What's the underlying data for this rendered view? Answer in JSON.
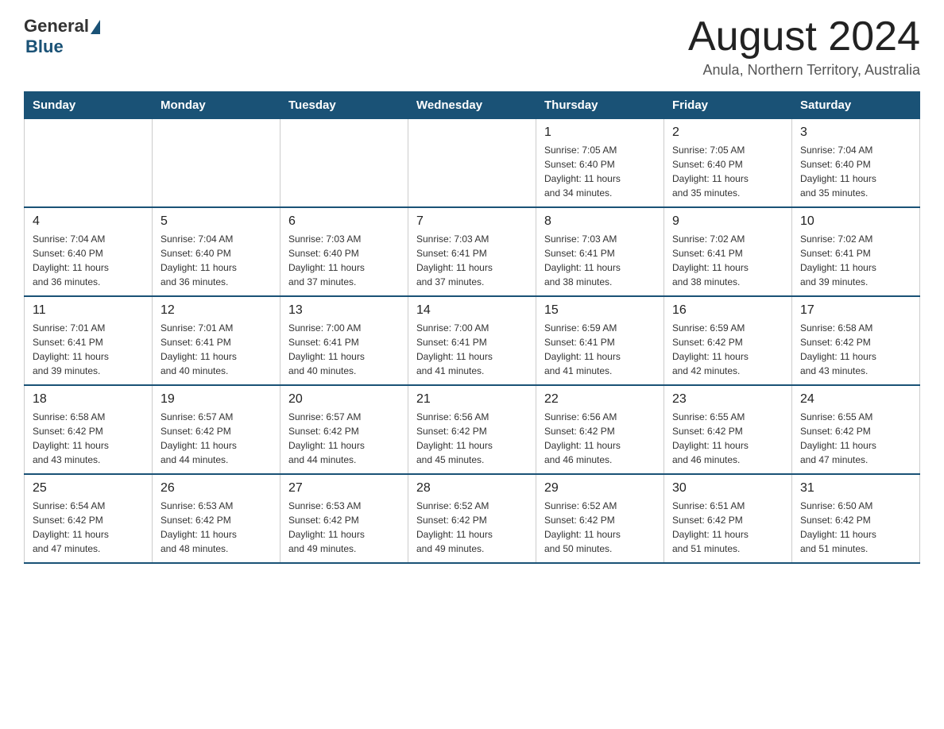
{
  "header": {
    "logo_general": "General",
    "logo_blue": "Blue",
    "month_title": "August 2024",
    "location": "Anula, Northern Territory, Australia"
  },
  "days_of_week": [
    "Sunday",
    "Monday",
    "Tuesday",
    "Wednesday",
    "Thursday",
    "Friday",
    "Saturday"
  ],
  "weeks": [
    [
      {
        "day": "",
        "info": ""
      },
      {
        "day": "",
        "info": ""
      },
      {
        "day": "",
        "info": ""
      },
      {
        "day": "",
        "info": ""
      },
      {
        "day": "1",
        "info": "Sunrise: 7:05 AM\nSunset: 6:40 PM\nDaylight: 11 hours\nand 34 minutes."
      },
      {
        "day": "2",
        "info": "Sunrise: 7:05 AM\nSunset: 6:40 PM\nDaylight: 11 hours\nand 35 minutes."
      },
      {
        "day": "3",
        "info": "Sunrise: 7:04 AM\nSunset: 6:40 PM\nDaylight: 11 hours\nand 35 minutes."
      }
    ],
    [
      {
        "day": "4",
        "info": "Sunrise: 7:04 AM\nSunset: 6:40 PM\nDaylight: 11 hours\nand 36 minutes."
      },
      {
        "day": "5",
        "info": "Sunrise: 7:04 AM\nSunset: 6:40 PM\nDaylight: 11 hours\nand 36 minutes."
      },
      {
        "day": "6",
        "info": "Sunrise: 7:03 AM\nSunset: 6:40 PM\nDaylight: 11 hours\nand 37 minutes."
      },
      {
        "day": "7",
        "info": "Sunrise: 7:03 AM\nSunset: 6:41 PM\nDaylight: 11 hours\nand 37 minutes."
      },
      {
        "day": "8",
        "info": "Sunrise: 7:03 AM\nSunset: 6:41 PM\nDaylight: 11 hours\nand 38 minutes."
      },
      {
        "day": "9",
        "info": "Sunrise: 7:02 AM\nSunset: 6:41 PM\nDaylight: 11 hours\nand 38 minutes."
      },
      {
        "day": "10",
        "info": "Sunrise: 7:02 AM\nSunset: 6:41 PM\nDaylight: 11 hours\nand 39 minutes."
      }
    ],
    [
      {
        "day": "11",
        "info": "Sunrise: 7:01 AM\nSunset: 6:41 PM\nDaylight: 11 hours\nand 39 minutes."
      },
      {
        "day": "12",
        "info": "Sunrise: 7:01 AM\nSunset: 6:41 PM\nDaylight: 11 hours\nand 40 minutes."
      },
      {
        "day": "13",
        "info": "Sunrise: 7:00 AM\nSunset: 6:41 PM\nDaylight: 11 hours\nand 40 minutes."
      },
      {
        "day": "14",
        "info": "Sunrise: 7:00 AM\nSunset: 6:41 PM\nDaylight: 11 hours\nand 41 minutes."
      },
      {
        "day": "15",
        "info": "Sunrise: 6:59 AM\nSunset: 6:41 PM\nDaylight: 11 hours\nand 41 minutes."
      },
      {
        "day": "16",
        "info": "Sunrise: 6:59 AM\nSunset: 6:42 PM\nDaylight: 11 hours\nand 42 minutes."
      },
      {
        "day": "17",
        "info": "Sunrise: 6:58 AM\nSunset: 6:42 PM\nDaylight: 11 hours\nand 43 minutes."
      }
    ],
    [
      {
        "day": "18",
        "info": "Sunrise: 6:58 AM\nSunset: 6:42 PM\nDaylight: 11 hours\nand 43 minutes."
      },
      {
        "day": "19",
        "info": "Sunrise: 6:57 AM\nSunset: 6:42 PM\nDaylight: 11 hours\nand 44 minutes."
      },
      {
        "day": "20",
        "info": "Sunrise: 6:57 AM\nSunset: 6:42 PM\nDaylight: 11 hours\nand 44 minutes."
      },
      {
        "day": "21",
        "info": "Sunrise: 6:56 AM\nSunset: 6:42 PM\nDaylight: 11 hours\nand 45 minutes."
      },
      {
        "day": "22",
        "info": "Sunrise: 6:56 AM\nSunset: 6:42 PM\nDaylight: 11 hours\nand 46 minutes."
      },
      {
        "day": "23",
        "info": "Sunrise: 6:55 AM\nSunset: 6:42 PM\nDaylight: 11 hours\nand 46 minutes."
      },
      {
        "day": "24",
        "info": "Sunrise: 6:55 AM\nSunset: 6:42 PM\nDaylight: 11 hours\nand 47 minutes."
      }
    ],
    [
      {
        "day": "25",
        "info": "Sunrise: 6:54 AM\nSunset: 6:42 PM\nDaylight: 11 hours\nand 47 minutes."
      },
      {
        "day": "26",
        "info": "Sunrise: 6:53 AM\nSunset: 6:42 PM\nDaylight: 11 hours\nand 48 minutes."
      },
      {
        "day": "27",
        "info": "Sunrise: 6:53 AM\nSunset: 6:42 PM\nDaylight: 11 hours\nand 49 minutes."
      },
      {
        "day": "28",
        "info": "Sunrise: 6:52 AM\nSunset: 6:42 PM\nDaylight: 11 hours\nand 49 minutes."
      },
      {
        "day": "29",
        "info": "Sunrise: 6:52 AM\nSunset: 6:42 PM\nDaylight: 11 hours\nand 50 minutes."
      },
      {
        "day": "30",
        "info": "Sunrise: 6:51 AM\nSunset: 6:42 PM\nDaylight: 11 hours\nand 51 minutes."
      },
      {
        "day": "31",
        "info": "Sunrise: 6:50 AM\nSunset: 6:42 PM\nDaylight: 11 hours\nand 51 minutes."
      }
    ]
  ]
}
